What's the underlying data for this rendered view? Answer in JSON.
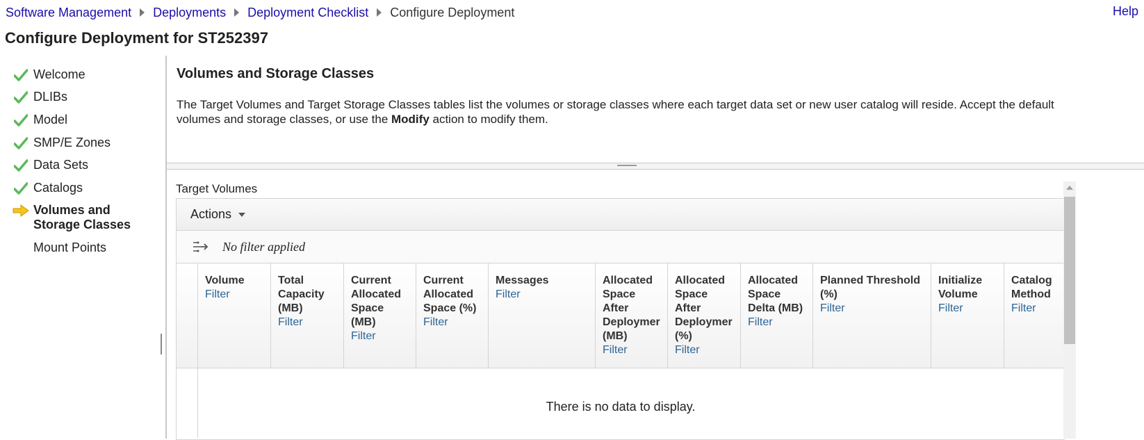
{
  "breadcrumb": {
    "items": [
      "Software Management",
      "Deployments",
      "Deployment Checklist"
    ],
    "current": "Configure Deployment"
  },
  "help_label": "Help",
  "page_title": "Configure Deployment for ST252397",
  "nav": {
    "items": [
      {
        "label": "Welcome",
        "status": "complete"
      },
      {
        "label": "DLIBs",
        "status": "complete"
      },
      {
        "label": "Model",
        "status": "complete"
      },
      {
        "label": "SMP/E Zones",
        "status": "complete"
      },
      {
        "label": "Data Sets",
        "status": "complete"
      },
      {
        "label": "Catalogs",
        "status": "complete"
      },
      {
        "label_line1": "Volumes and",
        "label_line2": "Storage Classes",
        "status": "current"
      },
      {
        "label": "Mount Points",
        "status": "pending"
      }
    ],
    "check_color": "#5cb85c",
    "arrow_color": "#f5c518"
  },
  "section": {
    "title": "Volumes and Storage Classes",
    "desc_before": "The Target Volumes and Target Storage Classes tables list the volumes or storage classes where each target data set or new user catalog will reside.  Accept the default volumes and storage classes, or use the ",
    "desc_bold": "Modify",
    "desc_after": " action to modify them."
  },
  "target_volumes": {
    "caption": "Target Volumes",
    "actions_label": "Actions",
    "filter_status": "No filter applied",
    "filter_link": "Filter",
    "columns": [
      {
        "lines": [
          "Volume"
        ]
      },
      {
        "lines": [
          "Total",
          "Capacity",
          "(MB)"
        ]
      },
      {
        "lines": [
          "Current",
          "Allocated",
          "Space",
          "(MB)"
        ]
      },
      {
        "lines": [
          "Current",
          "Allocated",
          "Space (%)"
        ]
      },
      {
        "lines": [
          "Messages"
        ]
      },
      {
        "lines": [
          "Allocated",
          "Space",
          "After",
          "Deploymer",
          "(MB)"
        ]
      },
      {
        "lines": [
          "Allocated",
          "Space",
          "After",
          "Deploymer",
          "(%)"
        ]
      },
      {
        "lines": [
          "Allocated",
          "Space",
          "Delta (MB)"
        ]
      },
      {
        "lines": [
          "Planned Threshold",
          "(%)"
        ]
      },
      {
        "lines": [
          "Initialize",
          "Volume"
        ]
      },
      {
        "lines": [
          "Catalog",
          "Method"
        ]
      }
    ],
    "empty_message": "There is no data to display."
  }
}
